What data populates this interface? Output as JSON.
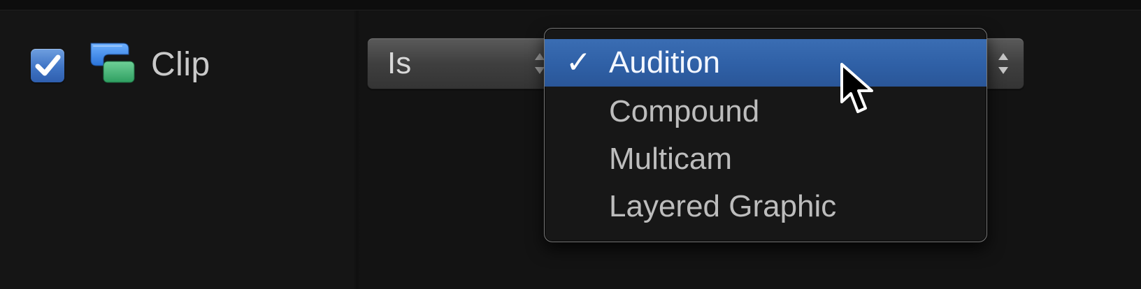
{
  "filter_row": {
    "checkbox": {
      "checked": true,
      "accent_color": "#4a7bd0"
    },
    "clip_icon_name": "clip-icon",
    "label": "Clip"
  },
  "operator_popup": {
    "value": "Is"
  },
  "menu": {
    "check_glyph": "✓",
    "items": [
      {
        "label": "Audition",
        "selected": true
      },
      {
        "label": "Compound",
        "selected": false
      },
      {
        "label": "Multicam",
        "selected": false
      },
      {
        "label": "Layered Graphic",
        "selected": false
      }
    ]
  },
  "cursor": {
    "type": "arrow-pointer"
  },
  "colors": {
    "background": "#141414",
    "menu_selection": "#2f60a6",
    "menu_border": "#7a7a7a",
    "text_primary": "#d0d0d0"
  }
}
